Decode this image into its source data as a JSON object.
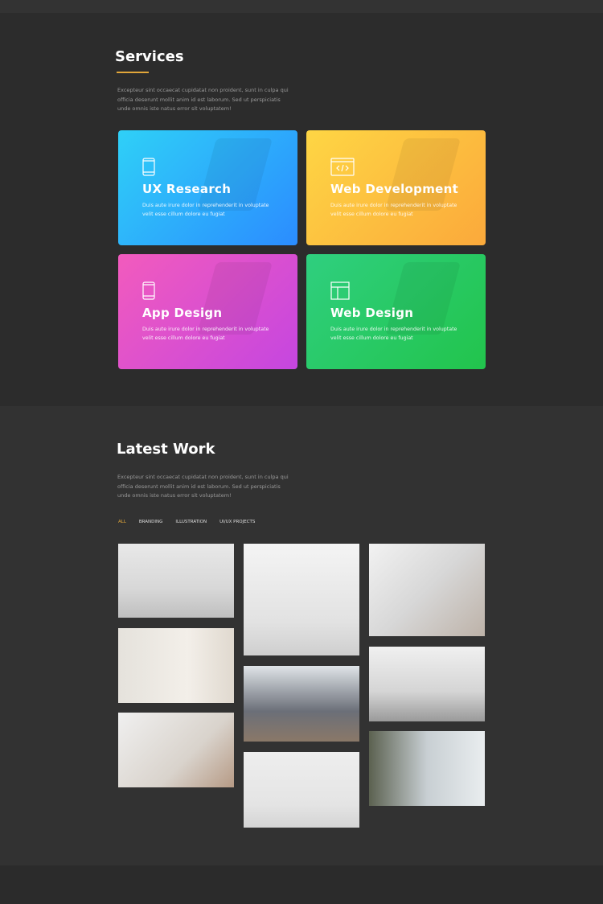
{
  "services": {
    "title": "Services",
    "description": "Excepteur sint occaecat cupidatat non proident, sunt in culpa qui officia deserunt mollit anim id est laborum. Sed ut perspiciatis unde omnis iste natus error sit voluptatem!",
    "accent": "#e2a73a",
    "cards": [
      {
        "title": "UX Research",
        "text": "Duis aute irure dolor in reprehenderit in voluptate velit esse cillum dolore eu fugiat",
        "icon": "mobile-icon",
        "colors": [
          "#2fd0f7",
          "#2b8cff"
        ]
      },
      {
        "title": "Web Development",
        "text": "Duis aute irure dolor in reprehenderit in voluptate velit esse cillum dolore eu fugiat",
        "icon": "code-window-icon",
        "colors": [
          "#fed644",
          "#fba93b"
        ]
      },
      {
        "title": "App Design",
        "text": "Duis aute irure dolor in reprehenderit in voluptate velit esse cillum dolore eu fugiat",
        "icon": "mobile-icon",
        "colors": [
          "#f25bbd",
          "#c546e0"
        ]
      },
      {
        "title": "Web Design",
        "text": "Duis aute irure dolor in reprehenderit in voluptate velit esse cillum dolore eu fugiat",
        "icon": "layout-icon",
        "colors": [
          "#2fcf7f",
          "#22c44c"
        ]
      }
    ]
  },
  "work": {
    "title": "Latest Work",
    "description": "Excepteur sint occaecat cupidatat non proident, sunt in culpa qui officia deserunt mollit anim id est laborum. Sed ut perspiciatis unde omnis iste natus error sit voluptatem!",
    "filters": [
      "ALL",
      "BRANDING",
      "ILLUSTRATION",
      "UI/UX PROJECTS"
    ],
    "active_filter": "ALL"
  }
}
